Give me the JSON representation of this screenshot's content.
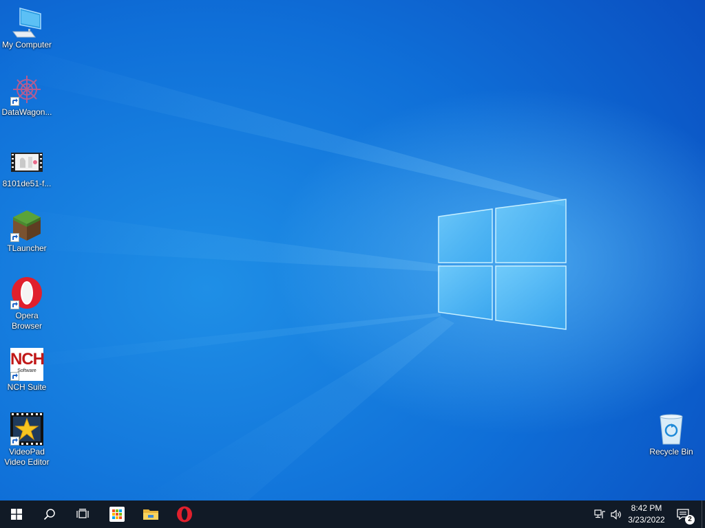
{
  "desktop": {
    "icons": [
      {
        "label": "My Computer"
      },
      {
        "label": "DataWagon..."
      },
      {
        "label": "8101de51-f..."
      },
      {
        "label": "TLauncher"
      },
      {
        "label": "Opera Browser"
      },
      {
        "label": "NCH Suite"
      },
      {
        "label": "VideoPad Video Editor"
      },
      {
        "label": "Recycle Bin"
      }
    ],
    "nch_logo_text": "NCH",
    "nch_logo_subtext": "Software"
  },
  "taskbar": {
    "start_icon": "windows-logo-icon",
    "search_icon": "search-icon",
    "task_view_icon": "task-view-icon",
    "pinned": [
      {
        "icon": "microsoft-store-icon"
      },
      {
        "icon": "file-explorer-icon"
      },
      {
        "icon": "opera-icon"
      }
    ],
    "tray": {
      "network_icon": "network-icon",
      "volume_icon": "volume-icon",
      "time": "8:42 PM",
      "date": "3/23/2022",
      "notification_count": "2"
    }
  },
  "colors": {
    "taskbar_bg": "#111a26",
    "desktop_blue": "#0f6fd8",
    "opera_red": "#e0202d"
  }
}
